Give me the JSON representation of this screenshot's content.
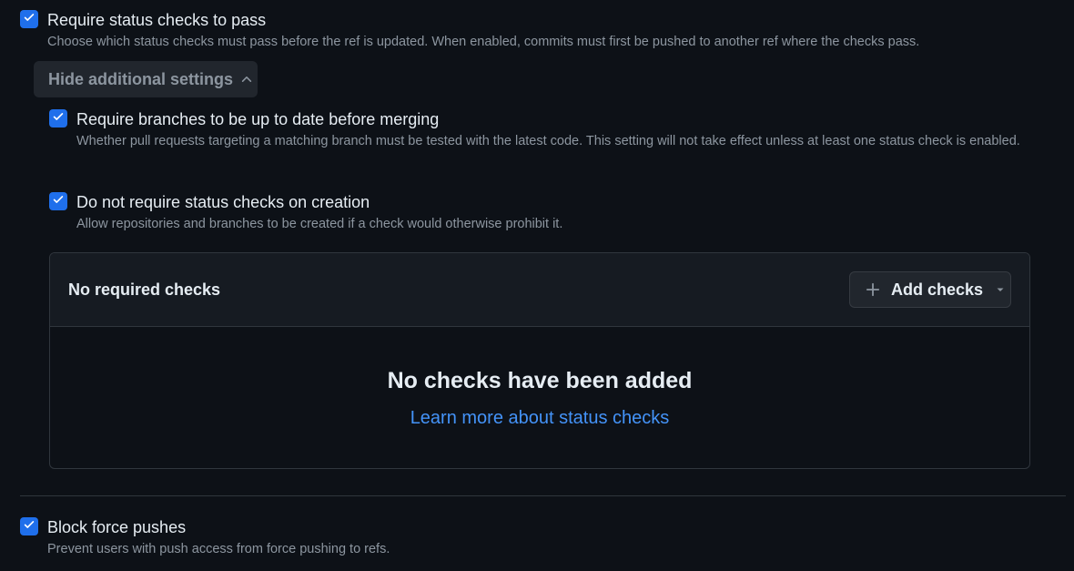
{
  "options": {
    "require_status": {
      "title": "Require status checks to pass",
      "description": "Choose which status checks must pass before the ref is updated. When enabled, commits must first be pushed to another ref where the checks pass."
    },
    "hide_settings_label": "Hide additional settings",
    "up_to_date": {
      "title": "Require branches to be up to date before merging",
      "description": "Whether pull requests targeting a matching branch must be tested with the latest code. This setting will not take effect unless at least one status check is enabled."
    },
    "no_require_creation": {
      "title": "Do not require status checks on creation",
      "description": "Allow repositories and branches to be created if a check would otherwise prohibit it."
    },
    "block_force": {
      "title": "Block force pushes",
      "description": "Prevent users with push access from force pushing to refs."
    }
  },
  "checks_panel": {
    "header_title": "No required checks",
    "add_button_label": "Add checks",
    "empty_title": "No checks have been added",
    "learn_more_link": "Learn more about status checks"
  },
  "colors": {
    "accent": "#1f6feb",
    "link": "#4493f8",
    "background": "#0d1117"
  },
  "icons": [
    "check-icon",
    "chevron-up-icon",
    "plus-icon",
    "caret-down-icon"
  ]
}
